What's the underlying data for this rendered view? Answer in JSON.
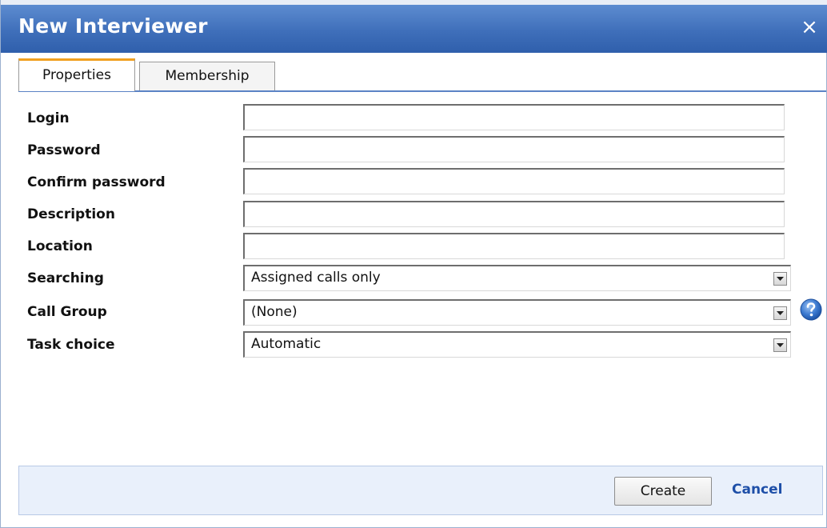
{
  "dialog": {
    "title": "New Interviewer",
    "close_glyph": "×"
  },
  "tabs": [
    {
      "label": "Properties",
      "active": true
    },
    {
      "label": "Membership",
      "active": false
    }
  ],
  "form": {
    "login": {
      "label": "Login",
      "value": ""
    },
    "password": {
      "label": "Password",
      "value": ""
    },
    "confirm_password": {
      "label": "Confirm password",
      "value": ""
    },
    "description": {
      "label": "Description",
      "value": ""
    },
    "location": {
      "label": "Location",
      "value": ""
    },
    "searching": {
      "label": "Searching",
      "value": "Assigned calls only"
    },
    "call_group": {
      "label": "Call Group",
      "value": "(None)"
    },
    "task_choice": {
      "label": "Task choice",
      "value": "Automatic"
    }
  },
  "footer": {
    "create_label": "Create",
    "cancel_label": "Cancel"
  },
  "colors": {
    "title_bar": "#3f6fba",
    "tab_accent": "#f0a020",
    "footer_bg": "#e9f0fb",
    "link": "#1e4fa8"
  },
  "icons": {
    "close": "close-icon",
    "dropdown": "chevron-down-icon",
    "help": "help-icon"
  }
}
